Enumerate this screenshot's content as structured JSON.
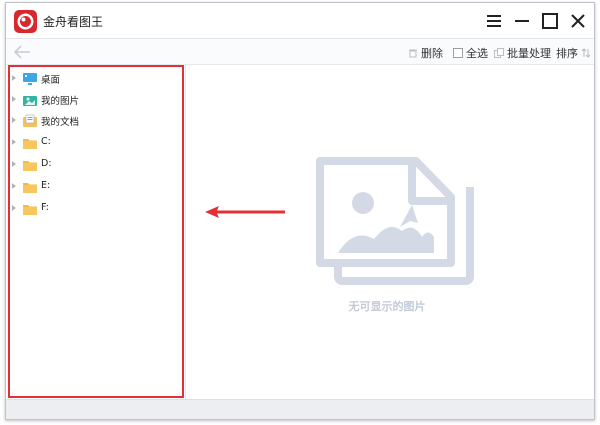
{
  "app": {
    "title": "金舟看图王"
  },
  "window_controls": {
    "menu": "menu-icon",
    "minimize": "minimize-icon",
    "maximize": "maximize-icon",
    "close": "close-icon"
  },
  "toolbar": {
    "delete_label": "删除",
    "select_all_label": "全选",
    "batch_label": "批量处理",
    "sort_label": "排序"
  },
  "sidebar": {
    "items": [
      {
        "label": "桌面",
        "icon": "desktop-icon"
      },
      {
        "label": "我的图片",
        "icon": "pictures-folder-icon"
      },
      {
        "label": "我的文档",
        "icon": "documents-folder-icon"
      },
      {
        "label": "C:",
        "icon": "folder-icon"
      },
      {
        "label": "D:",
        "icon": "folder-icon"
      },
      {
        "label": "E:",
        "icon": "folder-icon"
      },
      {
        "label": "F:",
        "icon": "folder-icon"
      }
    ]
  },
  "main": {
    "empty_text": "无可显示的图片"
  },
  "colors": {
    "brand": "#d9272e",
    "highlight": "#e52f36",
    "placeholder": "#d3dae5"
  }
}
